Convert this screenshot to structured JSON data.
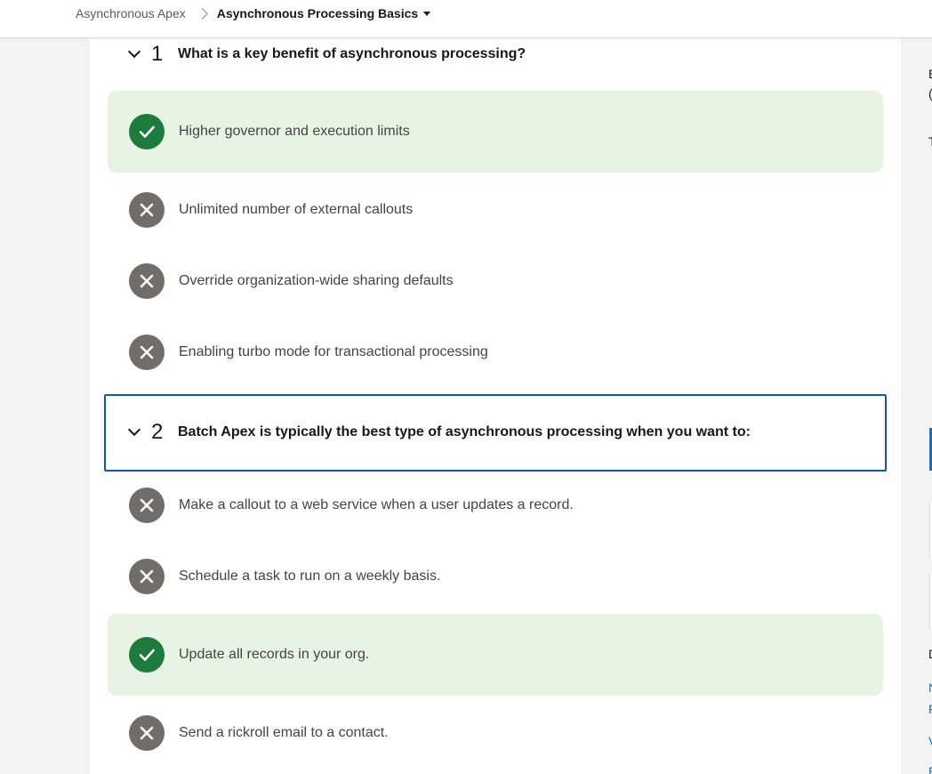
{
  "breadcrumb": {
    "parent": "Asynchronous Apex",
    "current": "Asynchronous Processing Basics"
  },
  "questions": [
    {
      "number": "1",
      "text": "What is a key benefit of asynchronous processing?",
      "answers": [
        {
          "text": "Higher governor and execution limits",
          "result": "correct"
        },
        {
          "text": "Unlimited number of external callouts",
          "result": "incorrect"
        },
        {
          "text": "Override organization-wide sharing defaults",
          "result": "incorrect"
        },
        {
          "text": "Enabling turbo mode for transactional processing",
          "result": "incorrect"
        }
      ]
    },
    {
      "number": "2",
      "text": "Batch Apex is typically the best type of asynchronous processing when you want to:",
      "answers": [
        {
          "text": "Make a callout to a web service when a user updates a record.",
          "result": "incorrect"
        },
        {
          "text": "Schedule a task to run on a weekly basis.",
          "result": "incorrect"
        },
        {
          "text": "Update all records in your org.",
          "result": "correct"
        },
        {
          "text": "Send a rickroll email to a contact.",
          "result": "incorrect"
        }
      ]
    }
  ],
  "right_panel": {
    "fragments": [
      "E",
      "(",
      "T",
      "D",
      "N",
      "F",
      "V",
      "E"
    ]
  },
  "colors": {
    "correct_badge": "#1e7b3e",
    "incorrect_badge": "#706e6b",
    "correct_bg": "#e8f4e3",
    "focus_border": "#0b5cab",
    "link_blue": "#0176d3"
  },
  "icons": {
    "correct": "check-icon",
    "incorrect": "x-icon",
    "expand": "chevron-down-icon",
    "breadcrumb_separator": "chevron-right-icon",
    "dropdown": "caret-down-icon"
  }
}
